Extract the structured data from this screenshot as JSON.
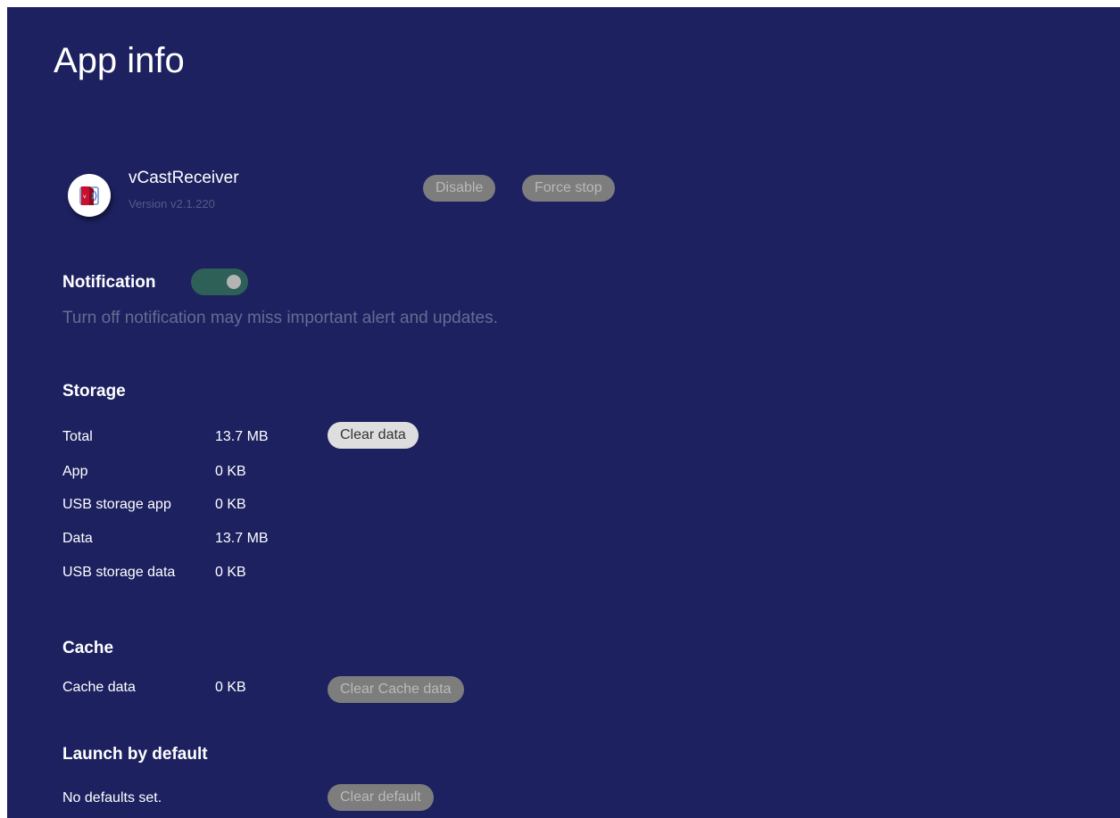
{
  "header": {
    "title": "App info"
  },
  "app": {
    "name": "vCastReceiver",
    "version": "Version v2.1.220",
    "icon": "vcast-receiver-app-icon"
  },
  "actions": {
    "disable_label": "Disable",
    "force_stop_label": "Force stop"
  },
  "notification": {
    "title": "Notification",
    "enabled": true,
    "description": "Turn off notification may miss important alert and updates."
  },
  "storage": {
    "title": "Storage",
    "rows": [
      {
        "label": "Total",
        "value": "13.7 MB"
      },
      {
        "label": "App",
        "value": "0 KB"
      },
      {
        "label": "USB storage app",
        "value": "0 KB"
      },
      {
        "label": "Data",
        "value": "13.7 MB"
      },
      {
        "label": "USB storage data",
        "value": "0 KB"
      }
    ],
    "clear_data_label": "Clear data"
  },
  "cache": {
    "title": "Cache",
    "label": "Cache data",
    "value": "0 KB",
    "clear_cache_label": "Clear Cache data"
  },
  "launch": {
    "title": "Launch by default",
    "status": "No defaults set.",
    "clear_default_label": "Clear default"
  },
  "colors": {
    "background": "#1d2160",
    "toggle_track": "#2f6058",
    "disabled_button": "#7d7d7d",
    "enabled_button": "#dedede",
    "muted_text": "#676b91"
  }
}
